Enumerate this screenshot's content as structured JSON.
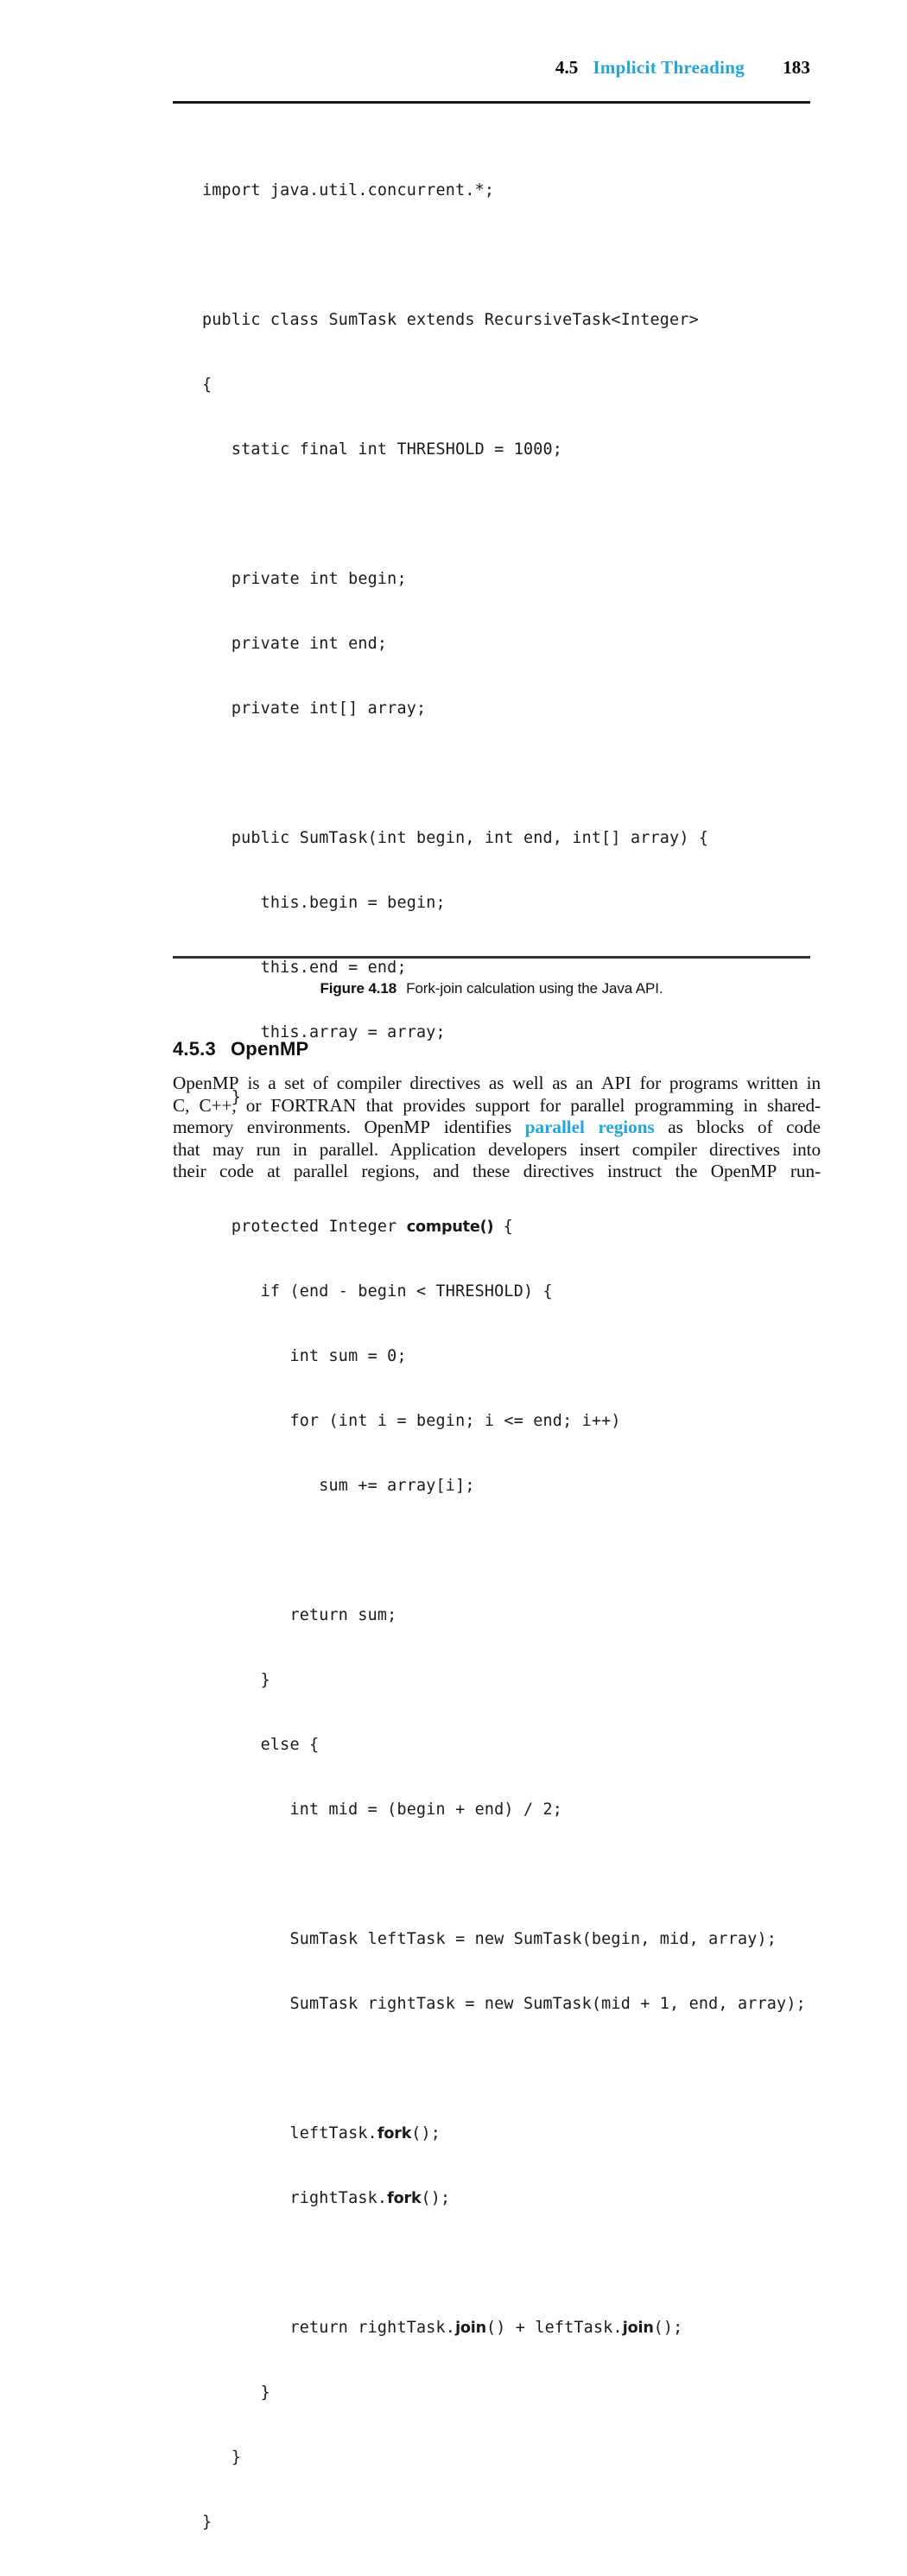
{
  "header": {
    "section_number": "4.5",
    "section_title": "Implicit Threading",
    "page_number": "183",
    "accent_color": "#22a5dd"
  },
  "code_listing": {
    "language": "Java",
    "lines": [
      "import java.util.concurrent.*;",
      "",
      "public class SumTask extends RecursiveTask<Integer>",
      "{",
      "   static final int THRESHOLD = 1000;",
      "",
      "   private int begin;",
      "   private int end;",
      "   private int[] array;",
      "",
      "   public SumTask(int begin, int end, int[] array) {",
      "      this.begin = begin;",
      "      this.end = end;",
      "      this.array = array;",
      "   }",
      "",
      "   protected Integer compute() {",
      "      if (end - begin < THRESHOLD) {",
      "         int sum = 0;",
      "         for (int i = begin; i <= end; i++)",
      "            sum += array[i];",
      "",
      "         return sum;",
      "      }",
      "      else {",
      "         int mid = (begin + end) / 2;",
      "",
      "         SumTask leftTask = new SumTask(begin, mid, array);",
      "         SumTask rightTask = new SumTask(mid + 1, end, array);",
      "",
      "         leftTask.fork();",
      "         rightTask.fork();",
      "",
      "         return rightTask.join() + leftTask.join();",
      "      }",
      "   }",
      "}"
    ],
    "bold_tokens": [
      "compute()",
      "fork",
      "join"
    ]
  },
  "figure_caption": {
    "label": "Figure 4.18",
    "text": "Fork-join calculation using the Java API."
  },
  "section": {
    "number": "4.5.3",
    "title": "OpenMP"
  },
  "paragraph": {
    "lines": [
      "OpenMP is a set of compiler directives as well as an API for programs written in",
      "C, C++, or FORTRAN that provides support for parallel programming in shared-",
      "memory environments. OpenMP identifies parallel regions as blocks of code",
      "that may run in parallel. Application developers insert compiler directives into",
      "their code at parallel regions, and these directives instruct the OpenMP run-"
    ],
    "emphasized_term": "parallel regions",
    "small_caps_terms": [
      "API",
      "FORTRAN",
      "MP"
    ]
  }
}
